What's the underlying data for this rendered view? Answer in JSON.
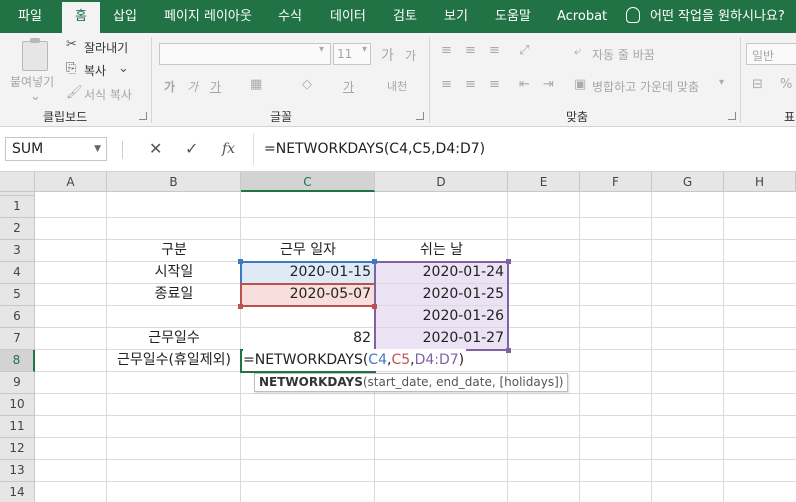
{
  "ribbon": {
    "tabs": [
      "파일",
      "홈",
      "삽입",
      "페이지 레이아웃",
      "수식",
      "데이터",
      "검토",
      "보기",
      "도움말",
      "Acrobat"
    ],
    "active_tab": "홈",
    "tell_me": "어떤 작업을 원하시나요?",
    "clipboard": {
      "paste": "붙여넣기",
      "cut": "잘라내기",
      "copy": "복사",
      "format_painter": "서식 복사",
      "label": "클립보드"
    },
    "font": {
      "name_value": "",
      "size_value": "11",
      "label": "글꼴",
      "grow": "가",
      "shrink": "가",
      "bold": "가",
      "italic": "가",
      "underline": "가",
      "phonetic": "내천"
    },
    "alignment": {
      "wrap": "자동 줄 바꿈",
      "merge": "병합하고 가운데 맞춤",
      "label": "맞춤"
    },
    "number": {
      "format": "일반",
      "label": "표"
    }
  },
  "formula_bar": {
    "name_box": "SUM",
    "cancel": "✕",
    "enter": "✓",
    "fx": "fx",
    "formula": "=NETWORKDAYS(C4,C5,D4:D7)"
  },
  "columns": [
    "A",
    "B",
    "C",
    "D",
    "E",
    "F",
    "G",
    "H"
  ],
  "rows": [
    "1",
    "2",
    "3",
    "4",
    "5",
    "6",
    "7",
    "8",
    "9",
    "10",
    "11",
    "12",
    "13",
    "14"
  ],
  "cells": {
    "B3": "구분",
    "C3": "근무 일자",
    "D3": "쉬는 날",
    "B4": "시작일",
    "C4": "2020-01-15",
    "D4": "2020-01-24",
    "B5": "종료일",
    "C5": "2020-05-07",
    "D5": "2020-01-25",
    "D6": "2020-01-26",
    "B7": "근무일수",
    "C7": "82",
    "D7": "2020-01-27",
    "B8": "근무일수(휴일제외)"
  },
  "editing": {
    "prefix": "=NETWORKDAYS(",
    "ref1": "C4",
    "comma1": ",",
    "ref2": "C5",
    "comma2": ",",
    "ref3": "D4:D7",
    "suffix": ")"
  },
  "tooltip": {
    "func": "NETWORKDAYS",
    "args": "(start_date, end_date, [holidays])"
  },
  "colors": {
    "excel_green": "#217346",
    "ref1": "#3c78c4",
    "ref2": "#c0504d",
    "ref3": "#8064a2"
  }
}
